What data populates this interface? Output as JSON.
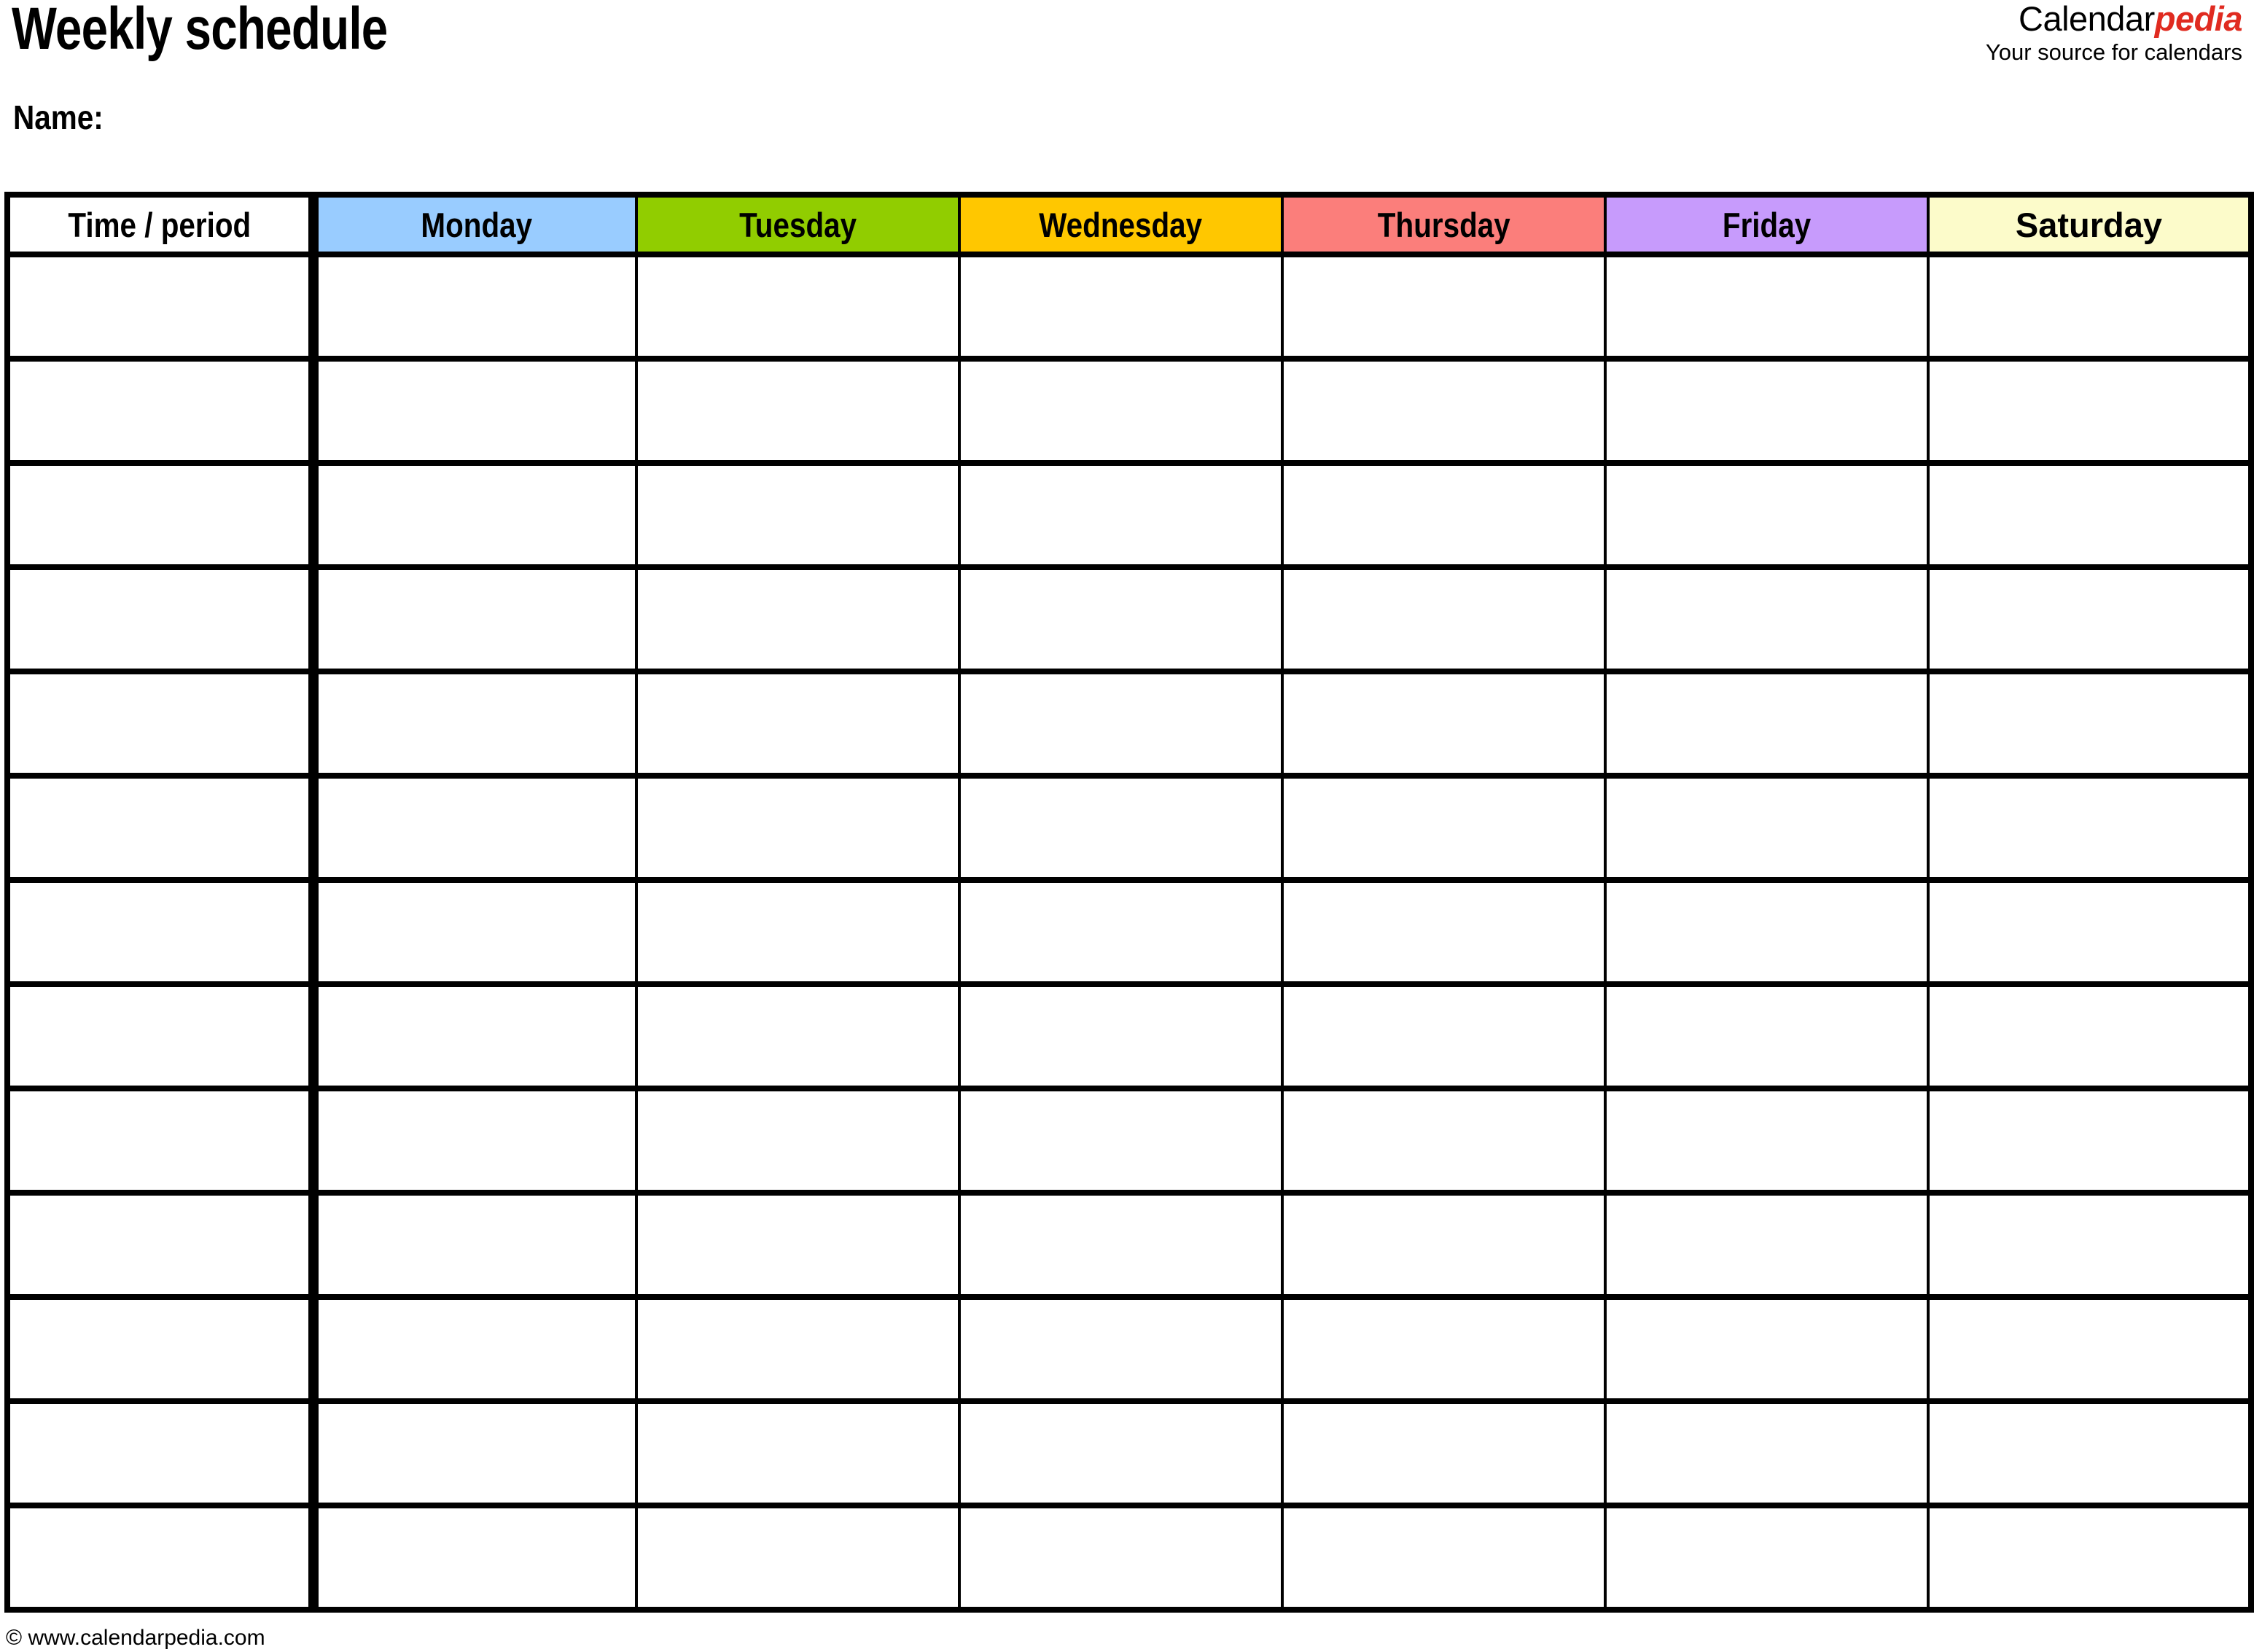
{
  "page": {
    "title": "Weekly schedule",
    "name_label": "Name:"
  },
  "logo": {
    "word_primary": "Calendar",
    "word_accent": "pedia",
    "tagline": "Your source for calendars",
    "accent_color": "#e02b20",
    "primary_color": "#000000"
  },
  "table": {
    "headers": [
      {
        "label": "Time / period",
        "bg": "#ffffff",
        "style": "condensed"
      },
      {
        "label": "Monday",
        "bg": "#99ccff",
        "style": "condensed"
      },
      {
        "label": "Tuesday",
        "bg": "#91cd00",
        "style": "condensed"
      },
      {
        "label": "Wednesday",
        "bg": "#ffc700",
        "style": "condensed"
      },
      {
        "label": "Thursday",
        "bg": "#fb7e7b",
        "style": "condensed"
      },
      {
        "label": "Friday",
        "bg": "#c79bfc",
        "style": "condensed"
      },
      {
        "label": "Saturday",
        "bg": "#fcfbca",
        "style": "wide"
      }
    ],
    "row_count": 13,
    "rows": [
      {
        "time": "",
        "cells": [
          "",
          "",
          "",
          "",
          "",
          ""
        ]
      },
      {
        "time": "",
        "cells": [
          "",
          "",
          "",
          "",
          "",
          ""
        ]
      },
      {
        "time": "",
        "cells": [
          "",
          "",
          "",
          "",
          "",
          ""
        ]
      },
      {
        "time": "",
        "cells": [
          "",
          "",
          "",
          "",
          "",
          ""
        ]
      },
      {
        "time": "",
        "cells": [
          "",
          "",
          "",
          "",
          "",
          ""
        ]
      },
      {
        "time": "",
        "cells": [
          "",
          "",
          "",
          "",
          "",
          ""
        ]
      },
      {
        "time": "",
        "cells": [
          "",
          "",
          "",
          "",
          "",
          ""
        ]
      },
      {
        "time": "",
        "cells": [
          "",
          "",
          "",
          "",
          "",
          ""
        ]
      },
      {
        "time": "",
        "cells": [
          "",
          "",
          "",
          "",
          "",
          ""
        ]
      },
      {
        "time": "",
        "cells": [
          "",
          "",
          "",
          "",
          "",
          ""
        ]
      },
      {
        "time": "",
        "cells": [
          "",
          "",
          "",
          "",
          "",
          ""
        ]
      },
      {
        "time": "",
        "cells": [
          "",
          "",
          "",
          "",
          "",
          ""
        ]
      },
      {
        "time": "",
        "cells": [
          "",
          "",
          "",
          "",
          "",
          ""
        ]
      }
    ]
  },
  "footer": {
    "copyright": "© www.calendarpedia.com"
  }
}
